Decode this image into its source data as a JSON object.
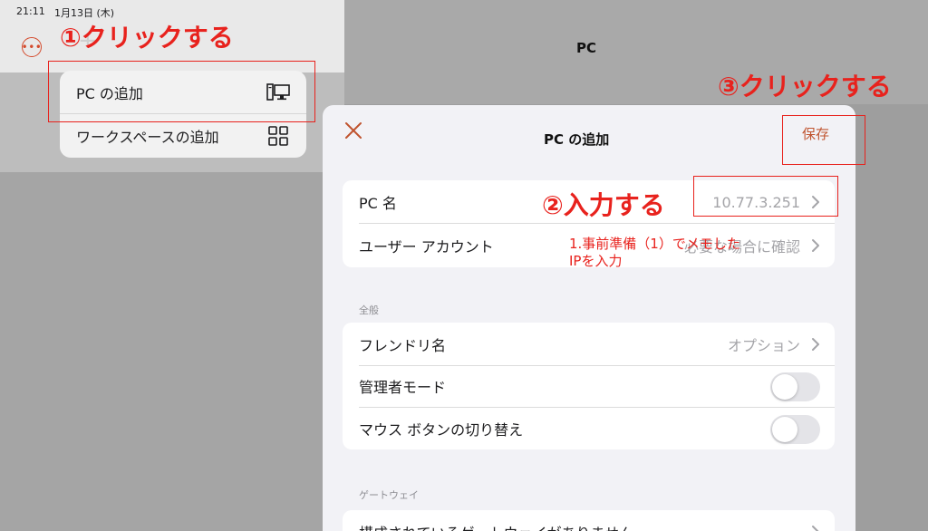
{
  "status_bar": {
    "time": "21:11",
    "date": "1月13日 (木)"
  },
  "left_panel": {
    "more_label": "•••",
    "plus_label": "+"
  },
  "popup_menu": {
    "items": [
      {
        "label": "PC の追加",
        "icon": "pc-icon"
      },
      {
        "label": "ワークスペースの追加",
        "icon": "grid-icon"
      }
    ]
  },
  "header": {
    "title": "PC"
  },
  "sheet": {
    "title": "PC の追加",
    "save_label": "保存",
    "rows_main": [
      {
        "label": "PC 名",
        "value": "10.77.3.251"
      },
      {
        "label": "ユーザー アカウント",
        "value": "必要な場合に確認"
      }
    ],
    "section_general": "全般",
    "rows_general": [
      {
        "label": "フレンドリ名",
        "value": "オプション"
      },
      {
        "label": "管理者モード",
        "toggle": false
      },
      {
        "label": "マウス ボタンの切り替え",
        "toggle": false
      }
    ],
    "section_gateway": "ゲートウェイ",
    "rows_gateway": [
      {
        "label": "構成されているゲートウェイがありません"
      }
    ]
  },
  "annotations": {
    "step1": "①クリックする",
    "step2": "②入力する",
    "step3": "③クリックする",
    "note_line1": "1.事前準備（1）でメモした",
    "note_line2": "IPを入力",
    "color": "#e8221d"
  },
  "colors": {
    "accent": "#c0542f",
    "annotation": "#e8221d",
    "sheet_bg": "#f2f2f6"
  }
}
